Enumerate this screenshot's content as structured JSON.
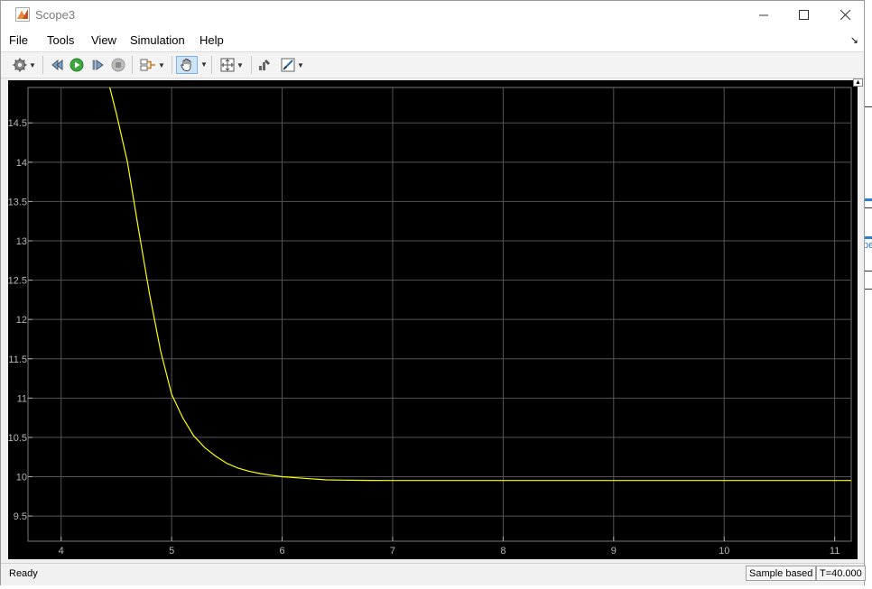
{
  "window": {
    "title": "Scope3"
  },
  "menu": [
    "File",
    "Tools",
    "View",
    "Simulation",
    "Help"
  ],
  "toolbar": {
    "items": [
      "configuration-properties",
      "step-back",
      "run",
      "step-forward",
      "stop",
      "signal-selector",
      "pan",
      "zoom-fit",
      "style",
      "measurements"
    ]
  },
  "status": {
    "left": "Ready",
    "mode": "Sample based",
    "time": "T=40.000"
  },
  "background_fragment": "pe",
  "chart_data": {
    "type": "line",
    "title": "",
    "xlabel": "",
    "ylabel": "",
    "xlim": [
      3.7,
      11.15
    ],
    "ylim": [
      9.18,
      14.95
    ],
    "xticks": [
      4,
      5,
      6,
      7,
      8,
      9,
      10,
      11
    ],
    "yticks": [
      9.5,
      10,
      10.5,
      11,
      11.5,
      12,
      12.5,
      13,
      13.5,
      14,
      14.5
    ],
    "xtick_labels": [
      "4",
      "5",
      "6",
      "7",
      "8",
      "9",
      "10",
      "11"
    ],
    "ytick_labels": [
      "9.5",
      "10",
      "10.5",
      "11",
      "11.5",
      "12",
      "12.5",
      "13",
      "13.5",
      "14",
      "14.5"
    ],
    "grid": true,
    "colors": {
      "background": "#000000",
      "axes": "#000000",
      "grid": "#555555",
      "tick": "#b8b8b8",
      "line": "#ffff00"
    },
    "series": [
      {
        "color": "#ffff00",
        "x": [
          4.44,
          4.5,
          4.6,
          4.7,
          4.8,
          4.9,
          5.0,
          5.1,
          5.2,
          5.3,
          5.4,
          5.5,
          5.6,
          5.7,
          5.8,
          5.9,
          6.0,
          6.2,
          6.4,
          6.6,
          6.8,
          7.0,
          8.0,
          9.0,
          10.0,
          11.15
        ],
        "y": [
          14.95,
          14.62,
          14.0,
          13.15,
          12.32,
          11.6,
          11.05,
          10.75,
          10.52,
          10.37,
          10.26,
          10.17,
          10.11,
          10.07,
          10.04,
          10.02,
          10.0,
          9.98,
          9.96,
          9.955,
          9.953,
          9.952,
          9.952,
          9.952,
          9.952,
          9.952
        ]
      }
    ]
  }
}
